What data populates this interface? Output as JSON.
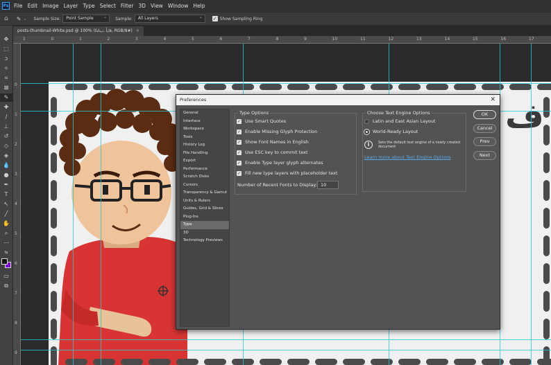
{
  "menubar": {
    "logo": "Ps",
    "items": [
      "File",
      "Edit",
      "Image",
      "Layer",
      "Type",
      "Select",
      "Filter",
      "3D",
      "View",
      "Window",
      "Help"
    ]
  },
  "options": {
    "sample_size_label": "Sample Size:",
    "sample_size_value": "Point Sample",
    "sample_label": "Sample:",
    "sample_value": "All Layers",
    "ring_label": "Show Sampling Ring",
    "ring_checked": true
  },
  "tab": {
    "title": "posts-thumbnail-White.psd @ 100% (ﻗﺎﻳﺃ ,ﺏﺎﺘﻛ, RGB/8#)",
    "close": "×"
  },
  "ruler": {
    "h": [
      "1",
      "0",
      "1",
      "2",
      "3",
      "4",
      "5",
      "6",
      "7",
      "8",
      "9",
      "10",
      "11",
      "12",
      "13",
      "14",
      "15",
      "16",
      "17"
    ],
    "v": [
      "0",
      "1",
      "2",
      "3",
      "4",
      "5",
      "6",
      "7",
      "8",
      "9"
    ]
  },
  "canvas": {
    "glyph": "ف"
  },
  "dialog": {
    "title": "Preferences",
    "close": "✕",
    "categories": [
      "General",
      "Interface",
      "Workspace",
      "Tools",
      "History Log",
      "File Handling",
      "Export",
      "Performance",
      "Scratch Disks",
      "Cursors",
      "Transparency & Gamut",
      "Units & Rulers",
      "Guides, Grid & Slices",
      "Plug-Ins",
      "Type",
      "3D",
      "Technology Previews"
    ],
    "active_category": "Type",
    "type_options": {
      "legend": "Type Options",
      "checks": [
        "Use Smart Quotes",
        "Enable Missing Glyph Protection",
        "Show Font Names in English",
        "Use ESC key to commit text",
        "Enable Type layer glyph alternates",
        "Fill new type layers with placeholder text"
      ],
      "recent_label": "Number of Recent Fonts to Display:",
      "recent_value": "10"
    },
    "engine": {
      "legend": "Choose Text Engine Options",
      "radios": [
        "Latin and East Asian Layout",
        "World-Ready Layout"
      ],
      "selected": "World-Ready Layout",
      "info": "Sets the default text engine of a newly created document",
      "link": "Learn more about Text Engine Options"
    },
    "buttons": {
      "ok": "OK",
      "cancel": "Cancel",
      "prev": "Prev",
      "next": "Next"
    }
  },
  "colors": {
    "accent": "#31a8ff",
    "guide": "#27c8d6",
    "shirt": "#d83434",
    "link": "#5aa8e6"
  }
}
